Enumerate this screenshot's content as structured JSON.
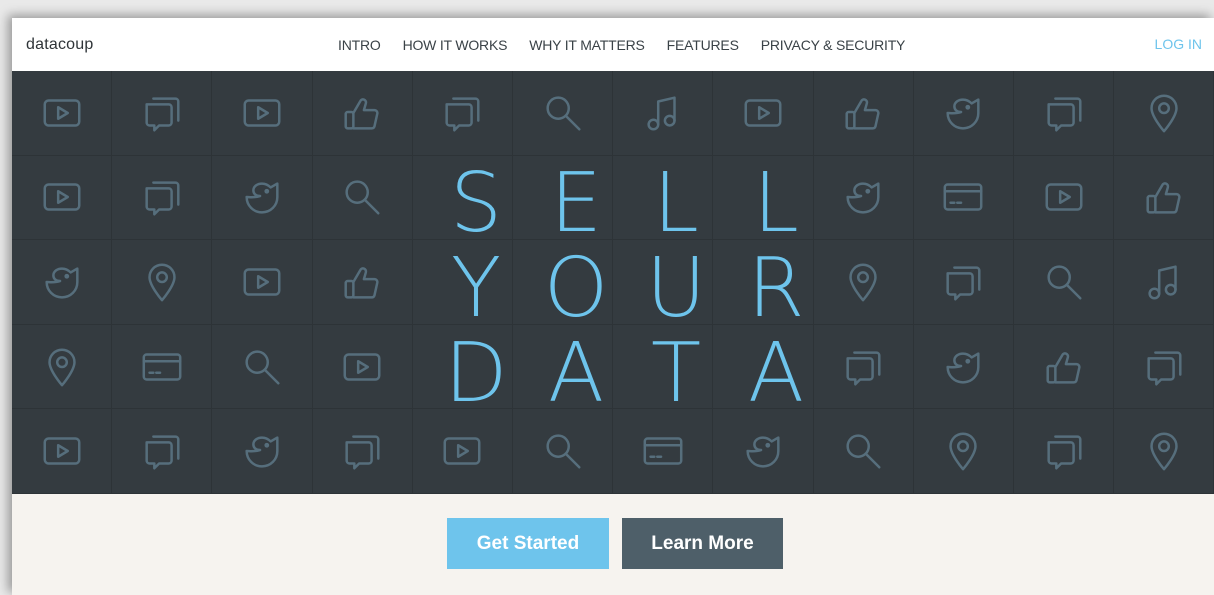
{
  "header": {
    "logo": "datacoup",
    "nav": [
      "INTRO",
      "HOW IT WORKS",
      "WHY IT MATTERS",
      "FEATURES",
      "PRIVACY & SECURITY"
    ],
    "login": "LOG IN"
  },
  "hero": {
    "lines": [
      "SELL",
      "YOUR",
      "DATA"
    ],
    "icon_grid": [
      [
        "video-icon",
        "chat-icon",
        "video-icon",
        "thumbs-up-icon",
        "chat-icon",
        "search-icon",
        "music-icon",
        "video-icon",
        "thumbs-up-icon",
        "bird-icon",
        "chat-icon",
        "location-icon"
      ],
      [
        "video-icon",
        "chat-icon",
        "bird-icon",
        "search-icon",
        "",
        "",
        "",
        "",
        "bird-icon",
        "card-icon",
        "video-icon",
        "thumbs-up-icon"
      ],
      [
        "bird-icon",
        "location-icon",
        "video-icon",
        "thumbs-up-icon",
        "",
        "",
        "",
        "",
        "location-icon",
        "chat-icon",
        "search-icon",
        "music-icon"
      ],
      [
        "location-icon",
        "card-icon",
        "search-icon",
        "video-icon",
        "",
        "",
        "",
        "",
        "chat-icon",
        "bird-icon",
        "thumbs-up-icon",
        "chat-icon"
      ],
      [
        "video-icon",
        "chat-icon",
        "bird-icon",
        "chat-icon",
        "video-icon",
        "search-icon",
        "card-icon",
        "bird-icon",
        "search-icon",
        "location-icon",
        "chat-icon",
        "location-icon"
      ]
    ]
  },
  "cta": {
    "primary": "Get Started",
    "secondary": "Learn More"
  },
  "colors": {
    "accent": "#6ec4ec",
    "hero_bg": "#343b40",
    "icon": "#566e7c",
    "secondary_button": "#4e5f69",
    "footer_bg": "#f6f3ef"
  }
}
